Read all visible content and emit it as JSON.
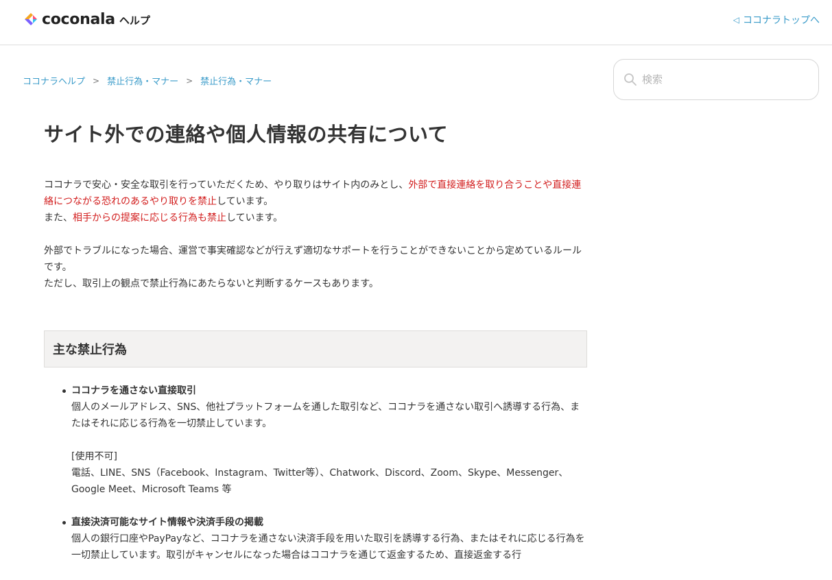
{
  "header": {
    "logo_word": "coconala",
    "logo_suffix": "ヘルプ",
    "top_link": "ココナラトップへ",
    "top_link_icon": "triangle-left-icon"
  },
  "breadcrumb": [
    "ココナラヘルプ",
    "禁止行為・マナー",
    "禁止行為・マナー"
  ],
  "breadcrumb_separator": ">",
  "search": {
    "placeholder": "検索",
    "value": ""
  },
  "article": {
    "title": "サイト外での連絡や個人情報の共有について",
    "p1_a": "ココナラで安心・安全な取引を行っていただくため、やり取りはサイト内のみとし、",
    "p1_red": "外部で直接連絡を取り合うことや直接連絡につながる恐れのあるやり取りを禁止",
    "p1_b": "しています。",
    "p1_c": "また、",
    "p1_red2": "相手からの提案に応じる行為も禁止",
    "p1_d": "しています。",
    "p2_a": "外部でトラブルになった場合、運営で事実確認などが行えず適切なサポートを行うことができないことから定めているルールです。",
    "p2_b": "ただし、取引上の観点で禁止行為にあたらないと判断するケースもあります。",
    "section_title": "主な禁止行為",
    "bullets": [
      {
        "title": "ココナラを通さない直接取引",
        "text": "個人のメールアドレス、SNS、他社プラットフォームを通した取引など、ココナラを通さない取引へ誘導する行為、またはそれに応じる行為を一切禁止しています。",
        "note_label": "[使用不可]",
        "note_text": "電話、LINE、SNS（Facebook、Instagram、Twitter等）、Chatwork、Discord、Zoom、Skype、Messenger、Google Meet、Microsoft Teams 等"
      },
      {
        "title": "直接決済可能なサイト情報や決済手段の掲載",
        "text": "個人の銀行口座やPayPayなど、ココナラを通さない決済手段を用いた取引を誘導する行為、またはそれに応じる行為を一切禁止しています。取引がキャンセルになった場合はココナラを通じて返金するため、直接返金する行"
      }
    ]
  },
  "colors": {
    "link": "#3a9bc9",
    "red": "#d21d1d",
    "text": "#333333",
    "section_bg": "#f3f2f1"
  }
}
